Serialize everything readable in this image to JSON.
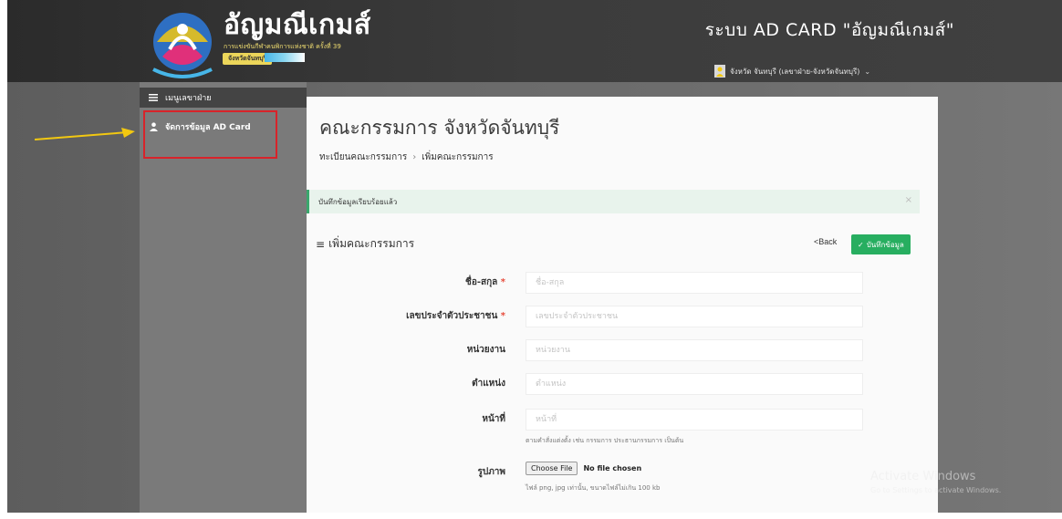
{
  "header": {
    "logo_title": "อัญมณีเกมส์",
    "logo_subtitle": "การแข่งขันกีฬาคนพิการแห่งชาติ ครั้งที่ 39",
    "logo_badge": "จังหวัดจันทบุรี",
    "system_title": "ระบบ AD CARD \"อัญมณีเกมส์\"",
    "user_name": "จังหวัด จันทบุรี (เลขาฝ่าย-จังหวัดจันทบุรี)"
  },
  "sidebar": {
    "items": [
      {
        "label": "เมนูเลขาฝ่าย",
        "icon": "menu-icon"
      },
      {
        "label": "จัดการข้อมูล AD Card",
        "icon": "user-icon"
      }
    ]
  },
  "main": {
    "page_title": "คณะกรรมการ จังหวัดจันทบุรี",
    "breadcrumb": [
      "ทะเบียนคณะกรรมการ",
      "เพิ่มคณะกรรมการ"
    ],
    "alert_text": "บันทึกข้อมูลเรียบร้อยแล้ว",
    "section_title": "เพิ่มคณะกรรมการ",
    "back_label": "<Back",
    "save_label": "บันทึกข้อมูล"
  },
  "form": {
    "name": {
      "label": "ชื่อ-สกุล",
      "required": "*",
      "placeholder": "ชื่อ-สกุล"
    },
    "id": {
      "label": "เลขประจำตัวประชาชน",
      "required": "*",
      "placeholder": "เลขประจำตัวประชาชน"
    },
    "unit": {
      "label": "หน่วยงาน",
      "placeholder": "หน่วยงาน"
    },
    "position": {
      "label": "ตำแหน่ง",
      "placeholder": "ตำแหน่ง"
    },
    "duty": {
      "label": "หน้าที่",
      "placeholder": "หน้าที่",
      "help": "ตามคำสั่งแต่งตั้ง เช่น กรรมการ ประธานกรรมการ เป็นต้น"
    },
    "photo": {
      "label": "รูปภาพ",
      "button": "Choose File",
      "status": "No file chosen",
      "help": "ไฟล์ png, jpg เท่านั้น, ขนาดไฟล์ไม่เกิน 100 kb"
    }
  },
  "watermark": {
    "line1": "Activate Windows",
    "line2": "Go to Settings to activate Windows."
  },
  "colors": {
    "header_bg": "#3a3a3a",
    "sidebar_bg": "#7a7a7a",
    "accent_green": "#27ae60",
    "annotation_red": "#d8232a",
    "arrow_yellow": "#f2c811"
  }
}
